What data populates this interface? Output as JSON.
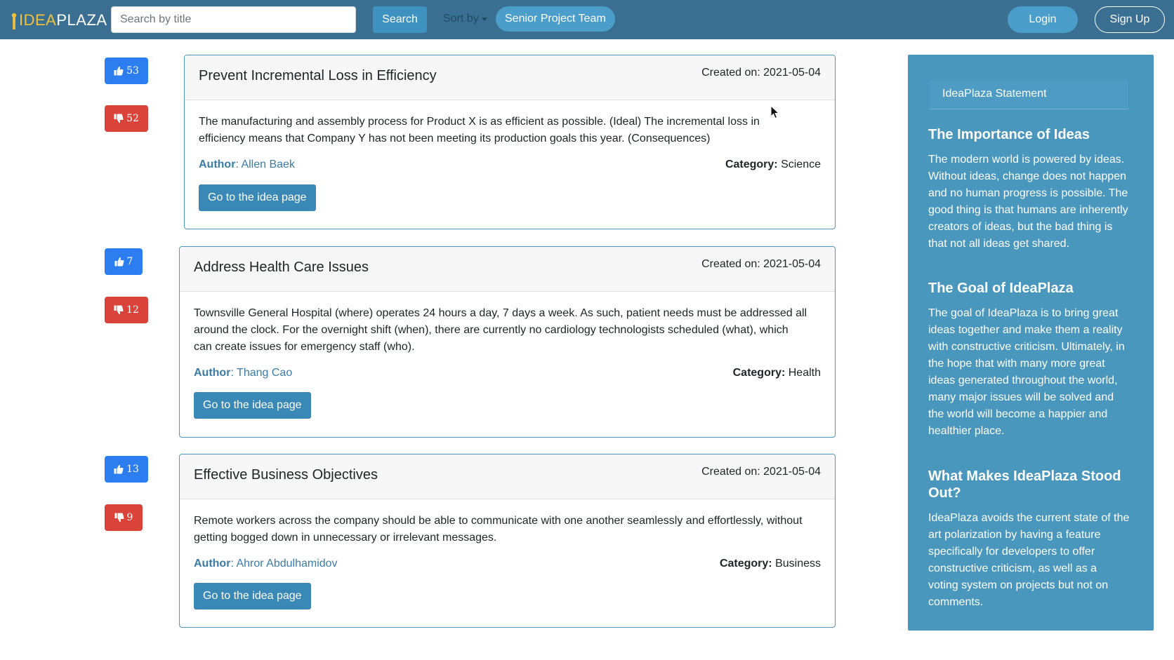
{
  "brand": {
    "part1": "IDEA",
    "part2": "PLAZA"
  },
  "navbar": {
    "search_placeholder": "Search by title",
    "search_button": "Search",
    "sort_by": "Sort by",
    "team_button": "Senior Project Team",
    "login": "Login",
    "signup": "Sign Up"
  },
  "ideas": [
    {
      "upvotes": "53",
      "downvotes": "52",
      "title": "Prevent Incremental Loss in Efficiency",
      "created": "Created on: 2021-05-04",
      "description_lines": [
        "The manufacturing and assembly process for Product X is as efficient as possible. (Ideal) The incremental loss in",
        "efficiency means that Company Y has not been meeting its production goals this year. (Consequences)"
      ],
      "author_label": "Author",
      "author": "Allen Baek",
      "category_label": "Category:",
      "category": "Science",
      "button": "Go to the idea page"
    },
    {
      "upvotes": "7",
      "downvotes": "12",
      "title": "Address Health Care Issues",
      "created": "Created on: 2021-05-04",
      "description_lines": [
        "Townsville General Hospital (where) operates 24 hours a day, 7 days a week. As such, patient needs must be addressed all",
        "around the clock. For the overnight shift (when), there are currently no cardiology technologists scheduled (what), which",
        "can create issues for emergency staff (who)."
      ],
      "author_label": "Author",
      "author": "Thang Cao",
      "category_label": "Category:",
      "category": "Health",
      "button": "Go to the idea page"
    },
    {
      "upvotes": "13",
      "downvotes": "9",
      "title": "Effective Business Objectives",
      "created": "Created on: 2021-05-04",
      "description_lines": [
        "Remote workers across the company should be able to communicate with one another seamlessly and effortlessly, without",
        "getting bogged down in unnecessary or irrelevant messages."
      ],
      "author_label": "Author",
      "author": "Ahror Abdulhamidov",
      "category_label": "Category:",
      "category": "Business",
      "button": "Go to the idea page"
    }
  ],
  "sidebar": {
    "statement": "IdeaPlaza Statement",
    "sections": [
      {
        "heading_lines": [
          "The Importance of Ideas"
        ],
        "text_lines": [
          "The modern world is powered by ideas.",
          "Without ideas, change does not happen",
          "and no human progress is possible. The",
          "good thing is that humans are inherently",
          "creators of ideas, but the bad thing is",
          "that not all ideas get shared."
        ]
      },
      {
        "heading_lines": [
          "The Goal of IdeaPlaza"
        ],
        "text_lines": [
          "The goal of IdeaPlaza is to bring great",
          "ideas together and make them a reality",
          "with constructive criticism. Ultimately, in",
          "the hope that with many more great",
          "ideas generated throughout the world,",
          "many major issues will be solved and",
          "the world will become a happier and",
          "healthier place."
        ]
      },
      {
        "heading_lines": [
          "What Makes IdeaPlaza Stood",
          "Out?"
        ],
        "text_lines": [
          "IdeaPlaza avoids the current state of the",
          "art polarization by having a feature",
          "specifically for developers to offer",
          "constructive criticism, as well as a",
          "voting system on projects but not on",
          "comments."
        ]
      }
    ]
  },
  "colors": {
    "navbar": "#3a6f91",
    "upvote": "#2b7df0",
    "downvote": "#d9433a",
    "sidebar": "#4a97bd",
    "button": "#3a88b5"
  },
  "icons": [
    "lightbulb-icon",
    "thumbs-up-icon",
    "thumbs-down-icon",
    "mouse-cursor-icon"
  ]
}
